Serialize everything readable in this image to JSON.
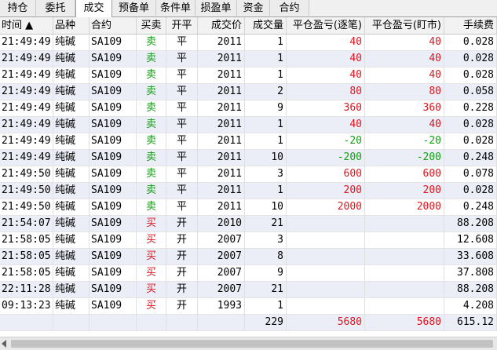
{
  "tabs": [
    "持仓",
    "委托",
    "成交",
    "预备单",
    "条件单",
    "损盈单",
    "资金",
    "合约"
  ],
  "active_tab": "成交",
  "columns": [
    "时间 ▲",
    "品种",
    "合约",
    "买卖",
    "开平",
    "成交价",
    "成交量",
    "平仓盈亏(逐笔)",
    "平仓盈亏(盯市)",
    "手续费"
  ],
  "rows": [
    {
      "time": "21:49:49",
      "product": "纯碱",
      "contract": "SA109",
      "side": "卖",
      "oc": "平",
      "price": "2011",
      "qty": "1",
      "pnl_trade": "40",
      "pnl_mtm": "40",
      "fee": "0.028"
    },
    {
      "time": "21:49:49",
      "product": "纯碱",
      "contract": "SA109",
      "side": "卖",
      "oc": "平",
      "price": "2011",
      "qty": "1",
      "pnl_trade": "40",
      "pnl_mtm": "40",
      "fee": "0.028"
    },
    {
      "time": "21:49:49",
      "product": "纯碱",
      "contract": "SA109",
      "side": "卖",
      "oc": "平",
      "price": "2011",
      "qty": "1",
      "pnl_trade": "40",
      "pnl_mtm": "40",
      "fee": "0.028"
    },
    {
      "time": "21:49:49",
      "product": "纯碱",
      "contract": "SA109",
      "side": "卖",
      "oc": "平",
      "price": "2011",
      "qty": "2",
      "pnl_trade": "80",
      "pnl_mtm": "80",
      "fee": "0.058"
    },
    {
      "time": "21:49:49",
      "product": "纯碱",
      "contract": "SA109",
      "side": "卖",
      "oc": "平",
      "price": "2011",
      "qty": "9",
      "pnl_trade": "360",
      "pnl_mtm": "360",
      "fee": "0.228"
    },
    {
      "time": "21:49:49",
      "product": "纯碱",
      "contract": "SA109",
      "side": "卖",
      "oc": "平",
      "price": "2011",
      "qty": "1",
      "pnl_trade": "40",
      "pnl_mtm": "40",
      "fee": "0.028"
    },
    {
      "time": "21:49:49",
      "product": "纯碱",
      "contract": "SA109",
      "side": "卖",
      "oc": "平",
      "price": "2011",
      "qty": "1",
      "pnl_trade": "-20",
      "pnl_mtm": "-20",
      "fee": "0.028"
    },
    {
      "time": "21:49:49",
      "product": "纯碱",
      "contract": "SA109",
      "side": "卖",
      "oc": "平",
      "price": "2011",
      "qty": "10",
      "pnl_trade": "-200",
      "pnl_mtm": "-200",
      "fee": "0.248"
    },
    {
      "time": "21:49:50",
      "product": "纯碱",
      "contract": "SA109",
      "side": "卖",
      "oc": "平",
      "price": "2011",
      "qty": "3",
      "pnl_trade": "600",
      "pnl_mtm": "600",
      "fee": "0.078"
    },
    {
      "time": "21:49:50",
      "product": "纯碱",
      "contract": "SA109",
      "side": "卖",
      "oc": "平",
      "price": "2011",
      "qty": "1",
      "pnl_trade": "200",
      "pnl_mtm": "200",
      "fee": "0.028"
    },
    {
      "time": "21:49:50",
      "product": "纯碱",
      "contract": "SA109",
      "side": "卖",
      "oc": "平",
      "price": "2011",
      "qty": "10",
      "pnl_trade": "2000",
      "pnl_mtm": "2000",
      "fee": "0.248"
    },
    {
      "time": "21:54:07",
      "product": "纯碱",
      "contract": "SA109",
      "side": "买",
      "oc": "开",
      "price": "2010",
      "qty": "21",
      "pnl_trade": "",
      "pnl_mtm": "",
      "fee": "88.208"
    },
    {
      "time": "21:58:05",
      "product": "纯碱",
      "contract": "SA109",
      "side": "买",
      "oc": "开",
      "price": "2007",
      "qty": "3",
      "pnl_trade": "",
      "pnl_mtm": "",
      "fee": "12.608"
    },
    {
      "time": "21:58:05",
      "product": "纯碱",
      "contract": "SA109",
      "side": "买",
      "oc": "开",
      "price": "2007",
      "qty": "8",
      "pnl_trade": "",
      "pnl_mtm": "",
      "fee": "33.608"
    },
    {
      "time": "21:58:05",
      "product": "纯碱",
      "contract": "SA109",
      "side": "买",
      "oc": "开",
      "price": "2007",
      "qty": "9",
      "pnl_trade": "",
      "pnl_mtm": "",
      "fee": "37.808"
    },
    {
      "time": "22:11:28",
      "product": "纯碱",
      "contract": "SA109",
      "side": "买",
      "oc": "开",
      "price": "2007",
      "qty": "21",
      "pnl_trade": "",
      "pnl_mtm": "",
      "fee": "88.208"
    },
    {
      "time": "09:13:23",
      "product": "纯碱",
      "contract": "SA109",
      "side": "买",
      "oc": "开",
      "price": "1993",
      "qty": "1",
      "pnl_trade": "",
      "pnl_mtm": "",
      "fee": "4.208"
    }
  ],
  "totals": {
    "qty": "229",
    "pnl_trade": "5680",
    "pnl_mtm": "5680",
    "fee": "615.12"
  },
  "colors": {
    "sell": "#12a012",
    "buy": "#e0141e",
    "profit": "#e0141e",
    "loss": "#12a012",
    "alt_row": "#ebeef6"
  }
}
